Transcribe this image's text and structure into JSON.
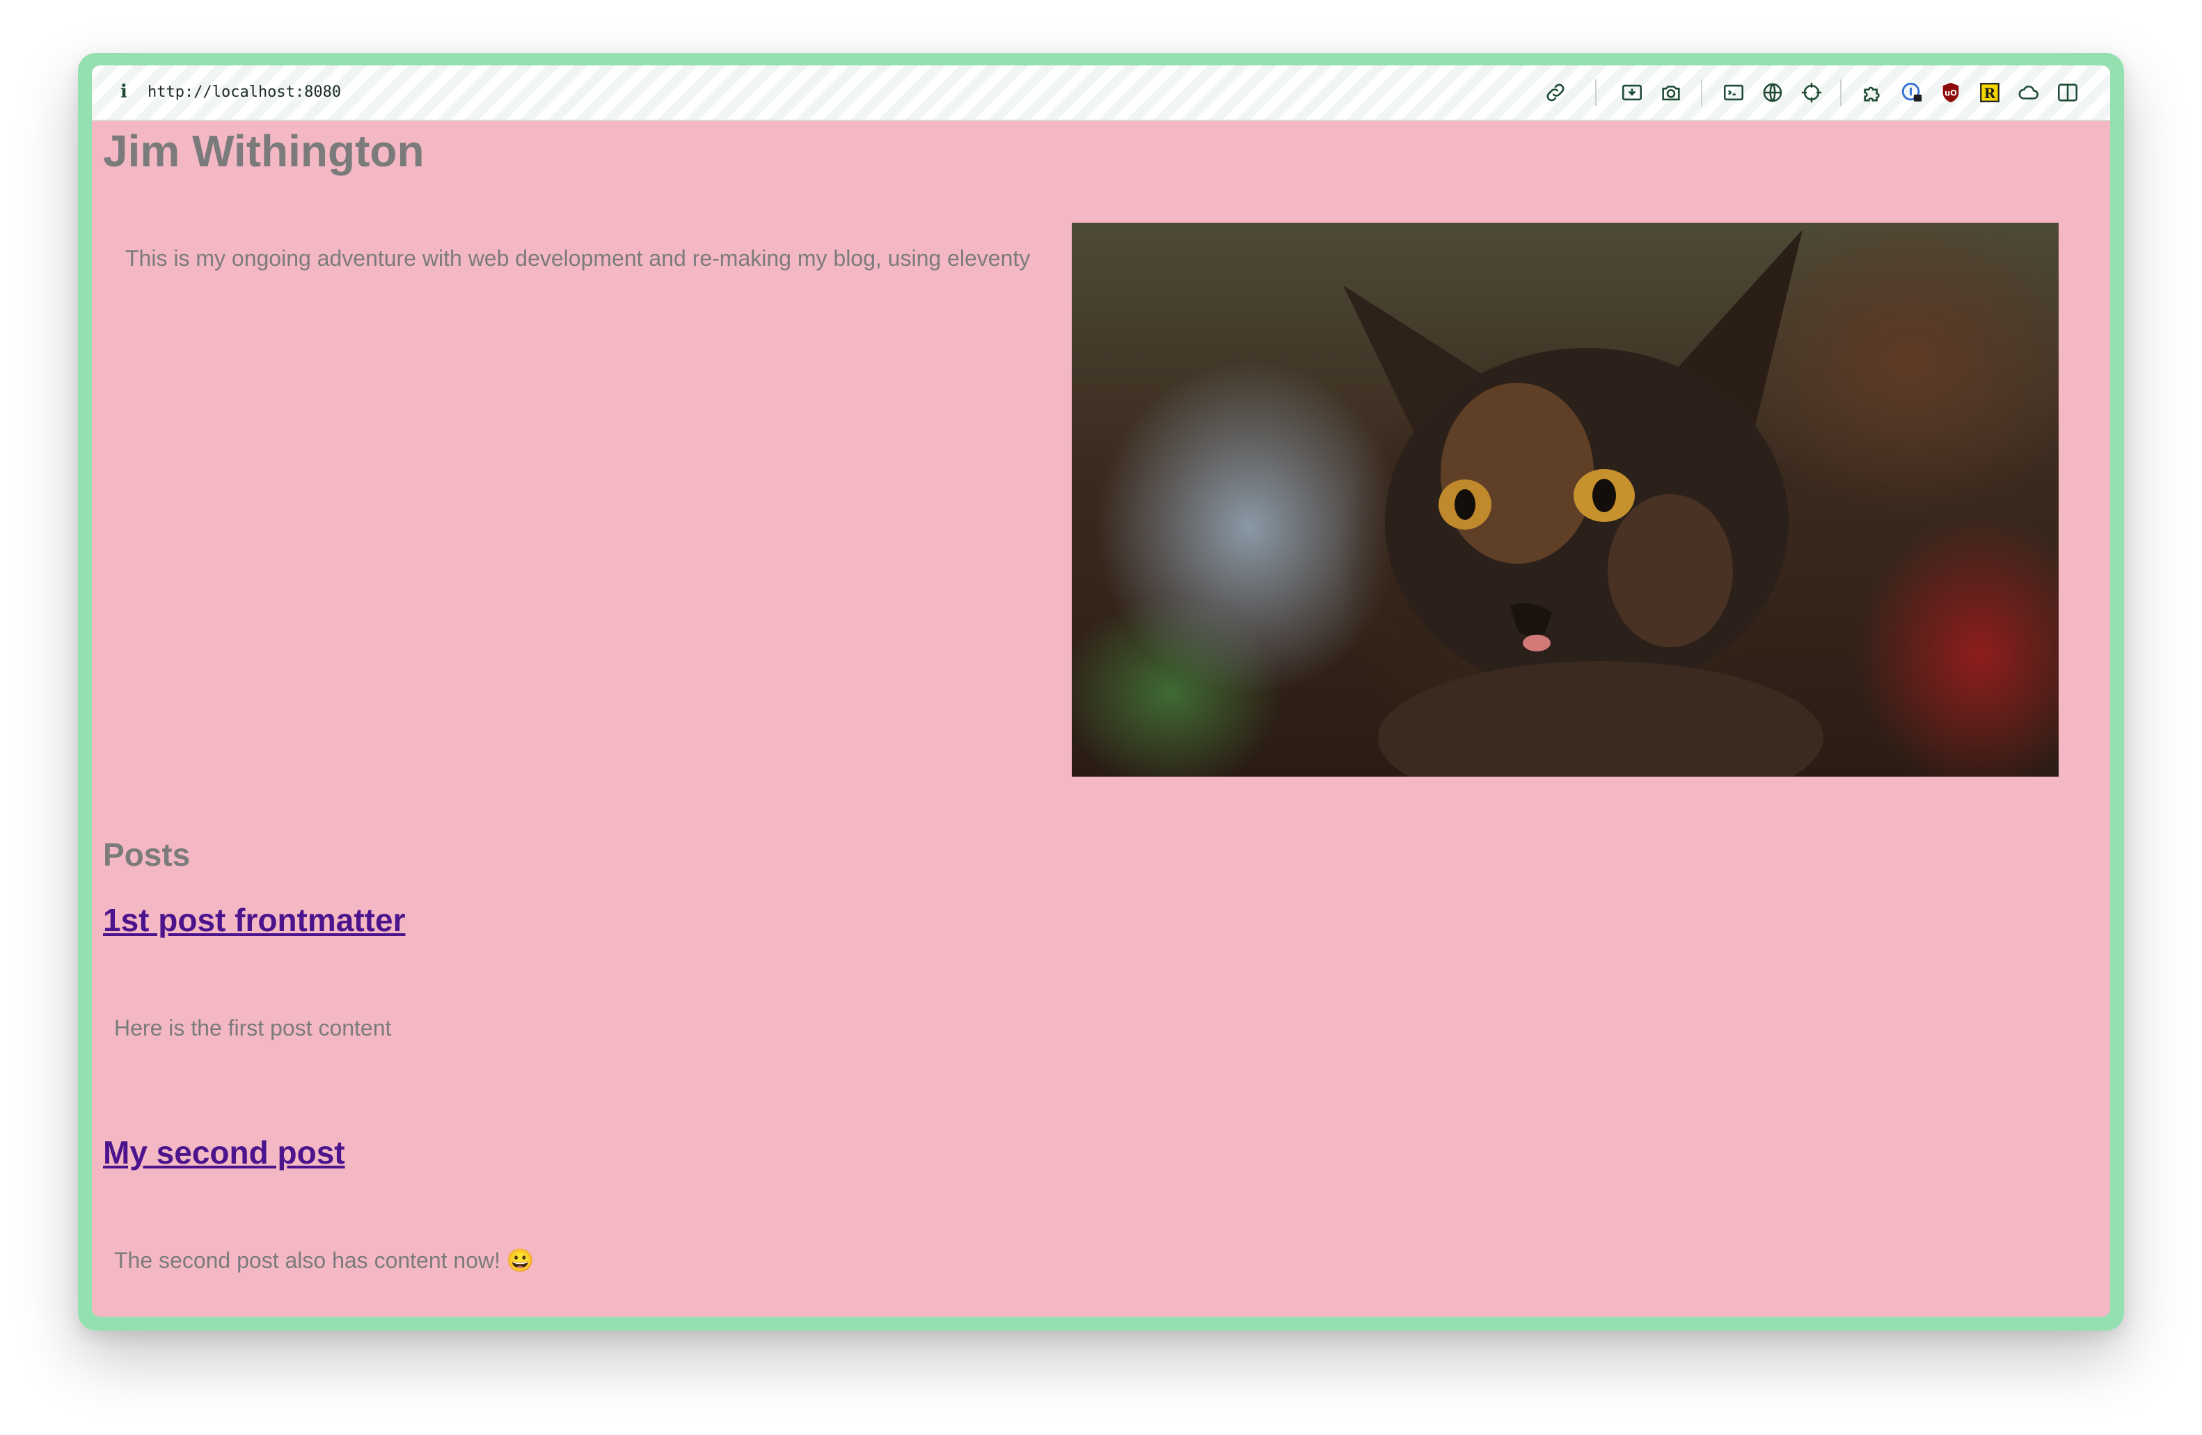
{
  "browser": {
    "url": "http://localhost:8080",
    "info_icon": "i",
    "toolbar_icons": [
      "link-icon",
      "save-icon",
      "camera-icon",
      "terminal-icon",
      "globe-icon",
      "crosshair-icon",
      "puzzle-icon",
      "password-icon",
      "ublock-icon",
      "r-extension-icon",
      "cloud-icon",
      "sidebar-icon"
    ],
    "accent_color": "#94e0b0",
    "page_background": "#f4b8c4"
  },
  "page": {
    "title": "Jim Withington",
    "intro": "This is my ongoing adventure with web development and re-making my blog, using eleventy",
    "hero_image_subject": "tortoiseshell kitten photo",
    "posts_heading": "Posts",
    "posts": [
      {
        "title": "1st post frontmatter",
        "body": "Here is the first post content"
      },
      {
        "title": "My second post",
        "body": "The second post also has content now! 😀"
      }
    ]
  }
}
